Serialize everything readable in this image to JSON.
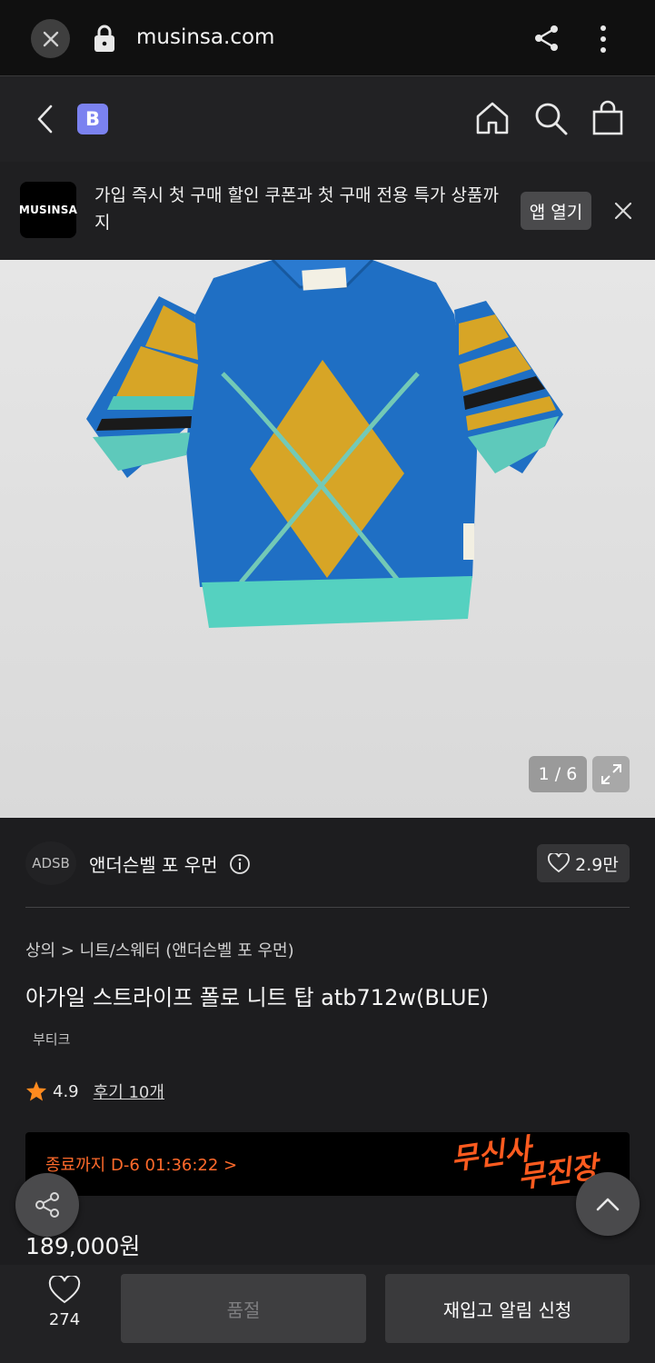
{
  "browser": {
    "url": "musinsa.com",
    "icons": [
      "close-icon",
      "lock-icon",
      "share-icon",
      "more-vert-icon"
    ]
  },
  "header": {
    "badge": "B",
    "icons": [
      "back-icon",
      "home-icon",
      "search-icon",
      "cart-icon"
    ]
  },
  "promo": {
    "logo": "MUSINSA",
    "text": "가입 즉시 첫 구매 할인 쿠폰과 첫 구매 전용 특가 상품까지",
    "button": "앱 열기"
  },
  "gallery": {
    "counter": "1 / 6"
  },
  "brand": {
    "logo": "ADSB",
    "name": "앤더슨벨 포 우먼",
    "likes": "2.9만"
  },
  "product": {
    "breadcrumb": "상의 > 니트/스웨터 (앤더슨벨 포 우먼)",
    "title": "아가일 스트라이프 폴로 니트 탑 atb712w(BLUE)",
    "store_tag": "부티크",
    "rating": "4.9",
    "reviews": "후기 10개",
    "price": "189,000원"
  },
  "countdown": {
    "text": "종료까지 D-6 01:36:22 >",
    "brand_line1": "무신사",
    "brand_line2": "무진장"
  },
  "bottom": {
    "wish_count": "274",
    "soldout": "품절",
    "restock": "재입고 알림 신청"
  },
  "colors": {
    "background": "#1d1d1f",
    "countdown_accent": "#ff5b1f",
    "badge": "#7b82f0"
  }
}
